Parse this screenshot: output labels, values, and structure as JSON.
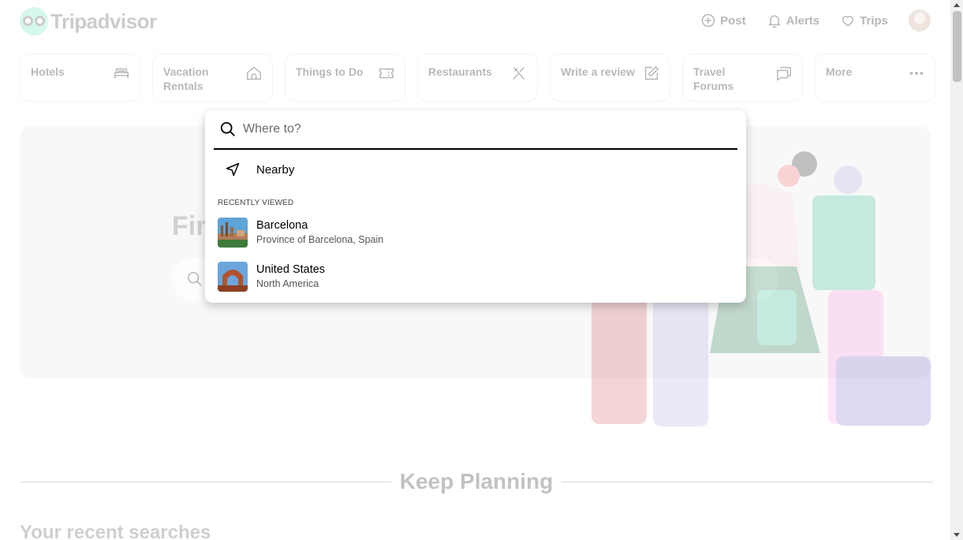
{
  "header": {
    "logo_text": "Tripadvisor",
    "nav": [
      {
        "label": "Post",
        "icon": "plus-circle-icon"
      },
      {
        "label": "Alerts",
        "icon": "bell-icon"
      },
      {
        "label": "Trips",
        "icon": "heart-icon"
      }
    ]
  },
  "tabs": [
    {
      "label": "Hotels",
      "icon": "bed-icon"
    },
    {
      "label": "Vacation Rentals",
      "icon": "house-icon"
    },
    {
      "label": "Things to Do",
      "icon": "ticket-icon"
    },
    {
      "label": "Restaurants",
      "icon": "fork-knife-icon"
    },
    {
      "label": "Write a review",
      "icon": "pencil-icon"
    },
    {
      "label": "Travel Forums",
      "icon": "chat-icon"
    },
    {
      "label": "More",
      "icon": "more-dots-icon"
    }
  ],
  "hero": {
    "title_fragment": "Fin"
  },
  "search_dropdown": {
    "placeholder": "Where to?",
    "value": "",
    "nearby_label": "Nearby",
    "recently_viewed_heading": "RECENTLY VIEWED",
    "recent": [
      {
        "name": "Barcelona",
        "subtitle": "Province of Barcelona, Spain"
      },
      {
        "name": "United States",
        "subtitle": "North America"
      }
    ]
  },
  "keep_planning": {
    "title": "Keep Planning",
    "recent_searches_title": "Your recent searches"
  },
  "colors": {
    "brand": "#34e0a1",
    "tab_border": "#d9d9d9",
    "hero_bg": "#f8f8f8"
  }
}
